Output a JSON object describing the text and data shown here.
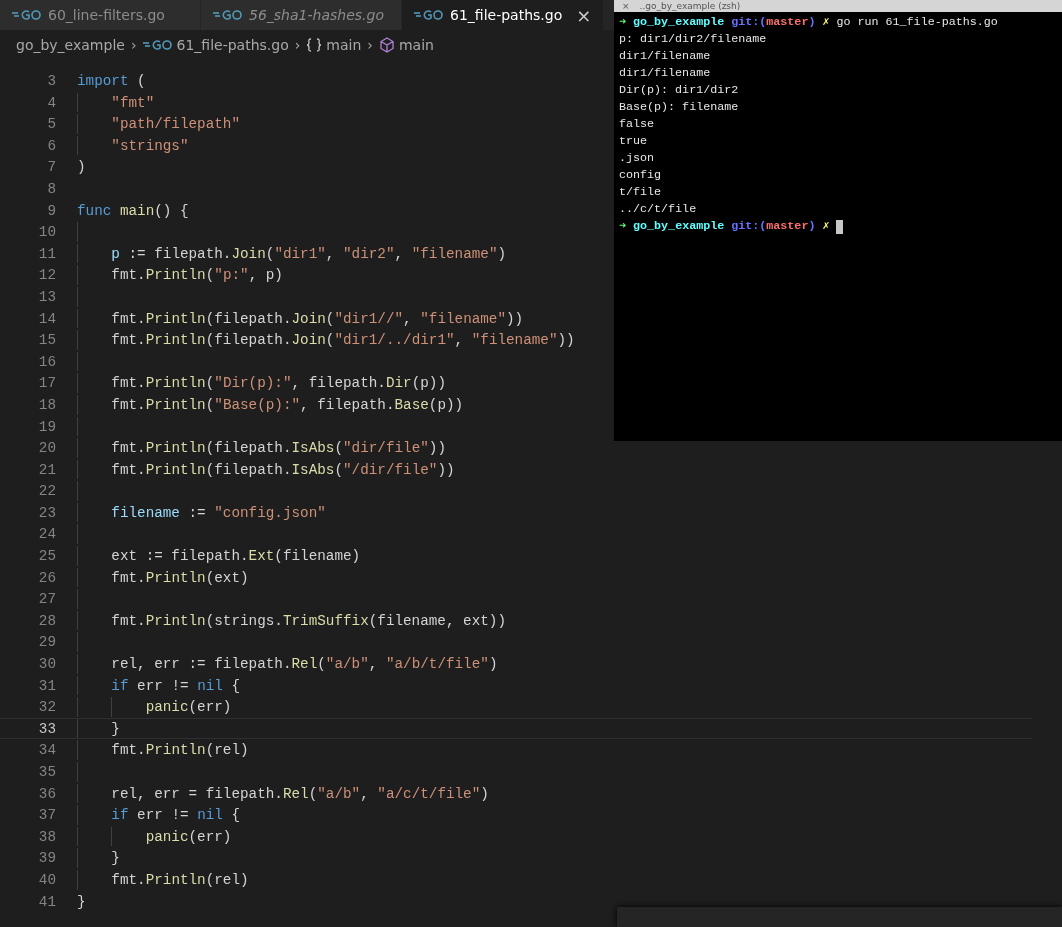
{
  "tabs": [
    {
      "label": "60_line-filters.go",
      "selected": false,
      "preview": false
    },
    {
      "label": "56_sha1-hashes.go",
      "selected": false,
      "preview": true
    },
    {
      "label": "61_file-paths.go",
      "selected": true,
      "preview": false,
      "close": "×"
    }
  ],
  "breadcrumb": [
    {
      "kind": "folder",
      "label": "go_by_example"
    },
    {
      "kind": "file",
      "label": "61_file-paths.go",
      "separator": "›"
    },
    {
      "kind": "braces",
      "label": "main",
      "separator": "›"
    },
    {
      "kind": "symbol",
      "label": "main",
      "separator": "›"
    }
  ],
  "editor": {
    "lines": [
      {
        "number": "3",
        "current": false,
        "tokens": [
          {
            "kind": "keyword",
            "text": "import"
          },
          {
            "kind": "plain",
            "text": " ("
          }
        ],
        "children": [
          {
            "number": "4",
            "current": false,
            "tokens": [
              {
                "kind": "string",
                "text": "\"fmt\""
              }
            ]
          },
          {
            "number": "5",
            "current": false,
            "tokens": [
              {
                "kind": "string",
                "text": "\"path/filepath\""
              }
            ]
          },
          {
            "number": "6",
            "current": false,
            "tokens": [
              {
                "kind": "string",
                "text": "\"strings\""
              }
            ]
          }
        ]
      },
      {
        "number": "7",
        "current": false,
        "tokens": [
          {
            "kind": "plain",
            "text": ")"
          }
        ]
      },
      {
        "number": "8",
        "current": false
      },
      {
        "number": "9",
        "current": false,
        "tokens": [
          {
            "kind": "keyword",
            "text": "func"
          },
          {
            "kind": "function",
            "text": " main"
          },
          {
            "kind": "plain",
            "text": "() {"
          }
        ],
        "children": [
          {
            "number": "10",
            "current": false
          },
          {
            "number": "11",
            "current": false,
            "tokens": [
              {
                "kind": "variable",
                "text": "p"
              },
              {
                "kind": "plain",
                "text": " := filepath."
              },
              {
                "kind": "function",
                "text": "Join"
              },
              {
                "kind": "plain",
                "text": "("
              },
              {
                "kind": "string",
                "text": "\"dir1\""
              },
              {
                "kind": "plain",
                "text": ", "
              },
              {
                "kind": "string",
                "text": "\"dir2\""
              },
              {
                "kind": "plain",
                "text": ", "
              },
              {
                "kind": "string",
                "text": "\"filename\""
              },
              {
                "kind": "plain",
                "text": ")"
              }
            ]
          },
          {
            "number": "12",
            "current": false,
            "tokens": [
              {
                "kind": "plain",
                "text": "fmt."
              },
              {
                "kind": "function",
                "text": "Println"
              },
              {
                "kind": "plain",
                "text": "("
              },
              {
                "kind": "string",
                "text": "\"p:\""
              },
              {
                "kind": "plain",
                "text": ", p)"
              }
            ]
          },
          {
            "number": "13",
            "current": false
          },
          {
            "number": "14",
            "current": false,
            "tokens": [
              {
                "kind": "plain",
                "text": "fmt."
              },
              {
                "kind": "function",
                "text": "Println"
              },
              {
                "kind": "plain",
                "text": "(filepath."
              },
              {
                "kind": "function",
                "text": "Join"
              },
              {
                "kind": "plain",
                "text": "("
              },
              {
                "kind": "string",
                "text": "\"dir1//\""
              },
              {
                "kind": "plain",
                "text": ", "
              },
              {
                "kind": "string",
                "text": "\"filename\""
              },
              {
                "kind": "plain",
                "text": "))"
              }
            ]
          },
          {
            "number": "15",
            "current": false,
            "tokens": [
              {
                "kind": "plain",
                "text": "fmt."
              },
              {
                "kind": "function",
                "text": "Println"
              },
              {
                "kind": "plain",
                "text": "(filepath."
              },
              {
                "kind": "function",
                "text": "Join"
              },
              {
                "kind": "plain",
                "text": "("
              },
              {
                "kind": "string",
                "text": "\"dir1/../dir1\""
              },
              {
                "kind": "plain",
                "text": ", "
              },
              {
                "kind": "string",
                "text": "\"filename\""
              },
              {
                "kind": "plain",
                "text": "))"
              }
            ]
          },
          {
            "number": "16",
            "current": false
          },
          {
            "number": "17",
            "current": false,
            "tokens": [
              {
                "kind": "plain",
                "text": "fmt."
              },
              {
                "kind": "function",
                "text": "Println"
              },
              {
                "kind": "plain",
                "text": "("
              },
              {
                "kind": "string",
                "text": "\"Dir(p):\""
              },
              {
                "kind": "plain",
                "text": ", filepath."
              },
              {
                "kind": "function",
                "text": "Dir"
              },
              {
                "kind": "plain",
                "text": "(p))"
              }
            ]
          },
          {
            "number": "18",
            "current": false,
            "tokens": [
              {
                "kind": "plain",
                "text": "fmt."
              },
              {
                "kind": "function",
                "text": "Println"
              },
              {
                "kind": "plain",
                "text": "("
              },
              {
                "kind": "string",
                "text": "\"Base(p):\""
              },
              {
                "kind": "plain",
                "text": ", filepath."
              },
              {
                "kind": "function",
                "text": "Base"
              },
              {
                "kind": "plain",
                "text": "(p))"
              }
            ]
          },
          {
            "number": "19",
            "current": false
          },
          {
            "number": "20",
            "current": false,
            "tokens": [
              {
                "kind": "plain",
                "text": "fmt."
              },
              {
                "kind": "function",
                "text": "Println"
              },
              {
                "kind": "plain",
                "text": "(filepath."
              },
              {
                "kind": "function",
                "text": "IsAbs"
              },
              {
                "kind": "plain",
                "text": "("
              },
              {
                "kind": "string",
                "text": "\"dir/file\""
              },
              {
                "kind": "plain",
                "text": "))"
              }
            ]
          },
          {
            "number": "21",
            "current": false,
            "tokens": [
              {
                "kind": "plain",
                "text": "fmt."
              },
              {
                "kind": "function",
                "text": "Println"
              },
              {
                "kind": "plain",
                "text": "(filepath."
              },
              {
                "kind": "function",
                "text": "IsAbs"
              },
              {
                "kind": "plain",
                "text": "("
              },
              {
                "kind": "string",
                "text": "\"/dir/file\""
              },
              {
                "kind": "plain",
                "text": "))"
              }
            ]
          },
          {
            "number": "22",
            "current": false
          },
          {
            "number": "23",
            "current": false,
            "tokens": [
              {
                "kind": "variable",
                "text": "filename"
              },
              {
                "kind": "plain",
                "text": " := "
              },
              {
                "kind": "string",
                "text": "\"config.json\""
              }
            ]
          },
          {
            "number": "24",
            "current": false
          },
          {
            "number": "25",
            "current": false,
            "tokens": [
              {
                "kind": "plain",
                "text": "ext := filepath."
              },
              {
                "kind": "function",
                "text": "Ext"
              },
              {
                "kind": "plain",
                "text": "(filename)"
              }
            ]
          },
          {
            "number": "26",
            "current": false,
            "tokens": [
              {
                "kind": "plain",
                "text": "fmt."
              },
              {
                "kind": "function",
                "text": "Println"
              },
              {
                "kind": "plain",
                "text": "(ext)"
              }
            ]
          },
          {
            "number": "27",
            "current": false
          },
          {
            "number": "28",
            "current": false,
            "tokens": [
              {
                "kind": "plain",
                "text": "fmt."
              },
              {
                "kind": "function",
                "text": "Println"
              },
              {
                "kind": "plain",
                "text": "(strings."
              },
              {
                "kind": "function",
                "text": "TrimSuffix"
              },
              {
                "kind": "plain",
                "text": "(filename, ext))"
              }
            ]
          },
          {
            "number": "29",
            "current": false
          },
          {
            "number": "30",
            "current": false,
            "tokens": [
              {
                "kind": "plain",
                "text": "rel, err := filepath."
              },
              {
                "kind": "function",
                "text": "Rel"
              },
              {
                "kind": "plain",
                "text": "("
              },
              {
                "kind": "string",
                "text": "\"a/b\""
              },
              {
                "kind": "plain",
                "text": ", "
              },
              {
                "kind": "string",
                "text": "\"a/b/t/file\""
              },
              {
                "kind": "plain",
                "text": ")"
              }
            ]
          },
          {
            "number": "31",
            "current": false,
            "tokens": [
              {
                "kind": "keyword",
                "text": "if"
              },
              {
                "kind": "plain",
                "text": " err != "
              },
              {
                "kind": "keyword",
                "text": "nil"
              },
              {
                "kind": "plain",
                "text": " {"
              }
            ],
            "children": [
              {
                "number": "32",
                "current": false,
                "tokens": [
                  {
                    "kind": "function",
                    "text": "panic"
                  },
                  {
                    "kind": "plain",
                    "text": "(err)"
                  }
                ]
              }
            ]
          },
          {
            "number": "33",
            "current": true,
            "tokens": [
              {
                "kind": "plain",
                "text": "}"
              }
            ]
          },
          {
            "number": "34",
            "current": false,
            "tokens": [
              {
                "kind": "plain",
                "text": "fmt."
              },
              {
                "kind": "function",
                "text": "Println"
              },
              {
                "kind": "plain",
                "text": "(rel)"
              }
            ]
          },
          {
            "number": "35",
            "current": false
          },
          {
            "number": "36",
            "current": false,
            "tokens": [
              {
                "kind": "plain",
                "text": "rel, err = filepath."
              },
              {
                "kind": "function",
                "text": "Rel"
              },
              {
                "kind": "plain",
                "text": "("
              },
              {
                "kind": "string",
                "text": "\"a/b\""
              },
              {
                "kind": "plain",
                "text": ", "
              },
              {
                "kind": "string",
                "text": "\"a/c/t/file\""
              },
              {
                "kind": "plain",
                "text": ")"
              }
            ]
          },
          {
            "number": "37",
            "current": false,
            "tokens": [
              {
                "kind": "keyword",
                "text": "if"
              },
              {
                "kind": "plain",
                "text": " err != "
              },
              {
                "kind": "keyword",
                "text": "nil"
              },
              {
                "kind": "plain",
                "text": " {"
              }
            ],
            "children": [
              {
                "number": "38",
                "current": false,
                "tokens": [
                  {
                    "kind": "function",
                    "text": "panic"
                  },
                  {
                    "kind": "plain",
                    "text": "(err)"
                  }
                ]
              }
            ]
          },
          {
            "number": "39",
            "current": false,
            "tokens": [
              {
                "kind": "plain",
                "text": "}"
              }
            ]
          },
          {
            "number": "40",
            "current": false,
            "tokens": [
              {
                "kind": "plain",
                "text": "fmt."
              },
              {
                "kind": "function",
                "text": "Println"
              },
              {
                "kind": "plain",
                "text": "(rel)"
              }
            ]
          }
        ]
      },
      {
        "number": "41",
        "current": false,
        "tokens": [
          {
            "kind": "plain",
            "text": "}"
          }
        ]
      }
    ]
  },
  "terminal": {
    "title": "..go_by_example (zsh)",
    "close": "×",
    "lines": [
      {
        "kind": "prompt",
        "parts": [
          {
            "kind": "arrow",
            "text": "➜"
          },
          {
            "kind": "dir",
            "text": "go_by_example"
          },
          {
            "kind": "git",
            "text": "git:("
          },
          {
            "kind": "branch",
            "text": "master"
          },
          {
            "kind": "git",
            "text": ")"
          },
          {
            "kind": "dirty",
            "text": "✗"
          },
          {
            "kind": "command",
            "text": "go run 61_file-paths.go"
          }
        ]
      },
      {
        "kind": "output",
        "text": "p: dir1/dir2/filename"
      },
      {
        "kind": "output",
        "text": "dir1/filename"
      },
      {
        "kind": "output",
        "text": "dir1/filename"
      },
      {
        "kind": "output",
        "text": "Dir(p): dir1/dir2"
      },
      {
        "kind": "output",
        "text": "Base(p): filename"
      },
      {
        "kind": "output",
        "text": "false"
      },
      {
        "kind": "output",
        "text": "true"
      },
      {
        "kind": "output",
        "text": ".json"
      },
      {
        "kind": "output",
        "text": "config"
      },
      {
        "kind": "output",
        "text": "t/file"
      },
      {
        "kind": "output",
        "text": "../c/t/file"
      },
      {
        "kind": "prompt",
        "cursor": true,
        "parts": [
          {
            "kind": "arrow",
            "text": "➜"
          },
          {
            "kind": "dir",
            "text": "go_by_example"
          },
          {
            "kind": "git",
            "text": "git:("
          },
          {
            "kind": "branch",
            "text": "master"
          },
          {
            "kind": "git",
            "text": ")"
          },
          {
            "kind": "dirty",
            "text": "✗"
          }
        ]
      }
    ]
  }
}
